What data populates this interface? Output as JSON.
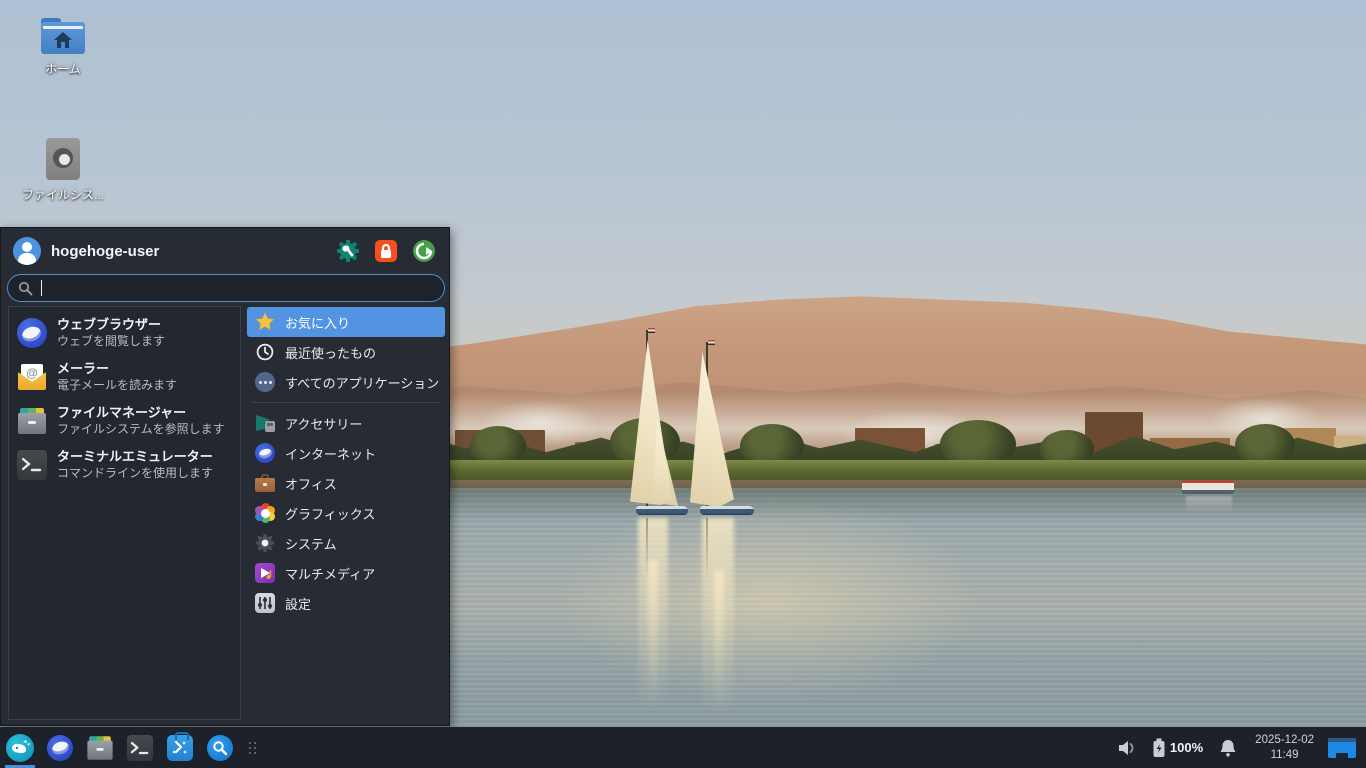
{
  "desktop": {
    "icons": [
      {
        "label": "ホーム",
        "icon": "home-folder-icon"
      },
      {
        "label": "ファイルシス...",
        "icon": "filesystem-drive-icon"
      }
    ]
  },
  "menu": {
    "username": "hogehoge-user",
    "header_buttons": [
      {
        "name": "settings-manager",
        "icon": "wrench-gear-icon"
      },
      {
        "name": "lock-screen",
        "icon": "lock-icon"
      },
      {
        "name": "log-out",
        "icon": "logout-icon"
      }
    ],
    "search": {
      "value": "",
      "placeholder": ""
    },
    "applications": [
      {
        "title": "ウェブブラウザー",
        "subtitle": "ウェブを閲覧します",
        "icon": "web-browser-icon"
      },
      {
        "title": "メーラー",
        "subtitle": "電子メールを読みます",
        "icon": "mailer-icon"
      },
      {
        "title": "ファイルマネージャー",
        "subtitle": "ファイルシステムを参照します",
        "icon": "file-manager-icon"
      },
      {
        "title": "ターミナルエミュレーター",
        "subtitle": "コマンドラインを使用します",
        "icon": "terminal-icon"
      }
    ],
    "categories": [
      {
        "label": "お気に入り",
        "icon": "star-icon",
        "selected": true
      },
      {
        "label": "最近使ったもの",
        "icon": "clock-icon",
        "selected": false
      },
      {
        "label": "すべてのアプリケーション",
        "icon": "all-apps-icon",
        "selected": false
      },
      {
        "label": "アクセサリー",
        "icon": "accessories-icon",
        "selected": false
      },
      {
        "label": "インターネット",
        "icon": "internet-icon",
        "selected": false
      },
      {
        "label": "オフィス",
        "icon": "office-icon",
        "selected": false
      },
      {
        "label": "グラフィックス",
        "icon": "graphics-icon",
        "selected": false
      },
      {
        "label": "システム",
        "icon": "system-icon",
        "selected": false
      },
      {
        "label": "マルチメディア",
        "icon": "multimedia-icon",
        "selected": false
      },
      {
        "label": "設定",
        "icon": "settings-icon",
        "selected": false
      }
    ],
    "icon_glyphs": {
      "mailer_at": "@"
    }
  },
  "taskbar": {
    "launchers": [
      {
        "name": "whisker-menu",
        "active": true
      },
      {
        "name": "web-browser",
        "active": false
      },
      {
        "name": "file-manager",
        "active": false
      },
      {
        "name": "terminal",
        "active": false
      },
      {
        "name": "software",
        "active": false
      },
      {
        "name": "app-finder",
        "active": false
      }
    ],
    "tray": {
      "battery_percent": "100%",
      "date": "2025-12-02",
      "time": "11:49"
    }
  },
  "colors": {
    "selection_blue": "#5294e2",
    "search_border": "#4a90d9",
    "menu_bg": "#272b34",
    "taskbar_bg": "#1d212a",
    "workspace_blue": "#1e88e5",
    "lock_orange": "#f4501e",
    "logout_green": "#43a047",
    "settings_teal": "#0e8570"
  }
}
